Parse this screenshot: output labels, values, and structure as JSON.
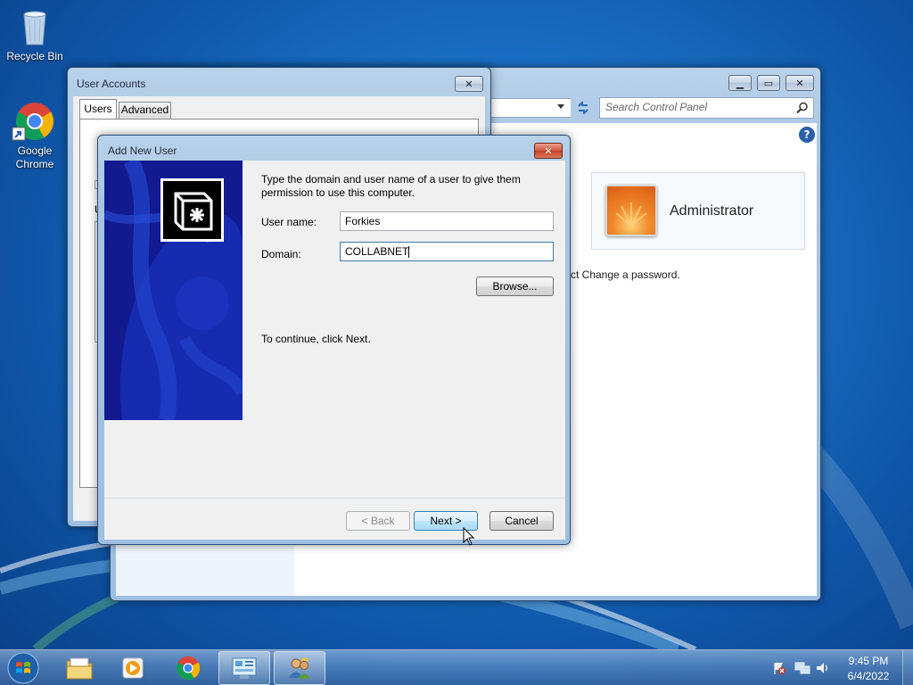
{
  "desktop": {
    "icons": [
      {
        "label": "Recycle Bin"
      },
      {
        "label": "Google Chrome"
      }
    ]
  },
  "control_panel": {
    "search_placeholder": "Search Control Panel",
    "user_tile_name": "Administrator",
    "change_password_text": "ct Change a password."
  },
  "user_accounts": {
    "title": "User Accounts",
    "tabs": [
      {
        "label": "Users"
      },
      {
        "label": "Advanced"
      }
    ],
    "partial_label": "U"
  },
  "add_user_dialog": {
    "title": "Add New User",
    "instructions": "Type the domain and user name of a user to give them permission to use this computer.",
    "user_name_label": "User name:",
    "user_name_value": "Forkies",
    "domain_label": "Domain:",
    "domain_value": "COLLABNET",
    "browse_label": "Browse...",
    "continue_text": "To continue, click Next.",
    "back_label": "< Back",
    "next_label": "Next >",
    "cancel_label": "Cancel"
  },
  "taskbar": {
    "clock_time": "9:45 PM",
    "clock_date": "6/4/2022"
  }
}
